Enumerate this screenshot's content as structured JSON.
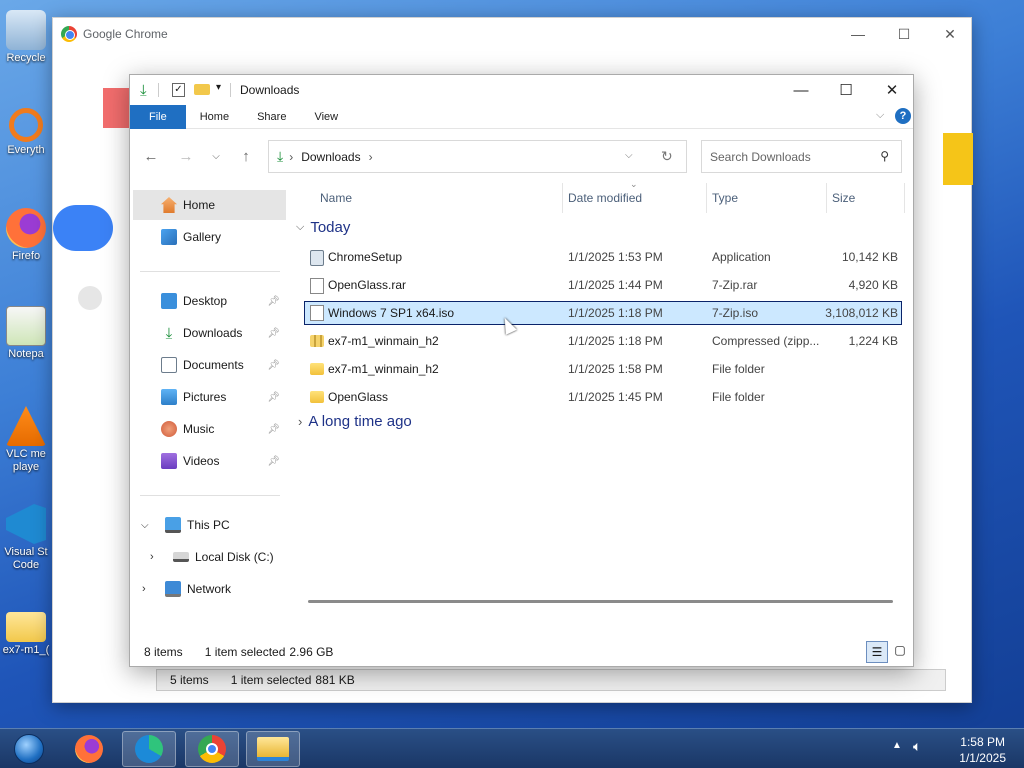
{
  "desktop": {
    "icons": [
      {
        "label": "Recycle",
        "icon": "recycle-bin-icon"
      },
      {
        "label": "Everyth",
        "icon": "everything-search-icon"
      },
      {
        "label": "Firefo",
        "icon": "firefox-icon"
      },
      {
        "label": "Notepa",
        "icon": "notepad-icon"
      },
      {
        "label": "VLC me playe",
        "icon": "vlc-icon"
      },
      {
        "label": "Visual St Code",
        "icon": "vscode-icon"
      },
      {
        "label": "ex7-m1_(",
        "icon": "folder-icon"
      }
    ]
  },
  "chrome_window": {
    "title": "Google Chrome",
    "status": {
      "items": "5 items",
      "selected": "1 item selected",
      "size": "881 KB"
    }
  },
  "explorer": {
    "title": "Downloads",
    "ribbon_tabs": [
      "File",
      "Home",
      "Share",
      "View"
    ],
    "address": {
      "folder": "Downloads"
    },
    "search_placeholder": "Search Downloads",
    "nav": {
      "home": "Home",
      "gallery": "Gallery",
      "quick_access": [
        "Desktop",
        "Downloads",
        "Documents",
        "Pictures",
        "Music",
        "Videos"
      ],
      "this_pc": "This PC",
      "local_disk": "Local Disk (C:)",
      "network": "Network"
    },
    "columns": {
      "name": "Name",
      "date": "Date modified",
      "type": "Type",
      "size": "Size"
    },
    "groups": {
      "today": "Today",
      "older": "A long time ago"
    },
    "files": [
      {
        "name": "ChromeSetup",
        "date": "1/1/2025 1:53 PM",
        "type": "Application",
        "size": "10,142 KB",
        "icon": "application-icon"
      },
      {
        "name": "OpenGlass.rar",
        "date": "1/1/2025 1:44 PM",
        "type": "7-Zip.rar",
        "size": "4,920 KB",
        "icon": "rar-file-icon"
      },
      {
        "name": "Windows 7 SP1 x64.iso",
        "date": "1/1/2025 1:18 PM",
        "type": "7-Zip.iso",
        "size": "3,108,012 KB",
        "icon": "iso-file-icon",
        "selected": true
      },
      {
        "name": "ex7-m1_winmain_h2",
        "date": "1/1/2025 1:18 PM",
        "type": "Compressed (zipp...",
        "size": "1,224 KB",
        "icon": "zip-folder-icon"
      },
      {
        "name": "ex7-m1_winmain_h2",
        "date": "1/1/2025 1:58 PM",
        "type": "File folder",
        "size": "",
        "icon": "folder-icon"
      },
      {
        "name": "OpenGlass",
        "date": "1/1/2025 1:45 PM",
        "type": "File folder",
        "size": "",
        "icon": "folder-icon"
      }
    ],
    "status": {
      "items": "8 items",
      "selected": "1 item selected",
      "size": "2.96 GB"
    }
  },
  "taskbar": {
    "apps": [
      "start-orb-icon",
      "firefox-icon",
      "edge-icon",
      "chrome-icon",
      "file-explorer-icon"
    ],
    "time": "1:58 PM",
    "date": "1/1/2025"
  },
  "colors": {
    "accent": "#1f6fc2",
    "selection": "#cce8ff",
    "group_text": "#1e3287"
  }
}
